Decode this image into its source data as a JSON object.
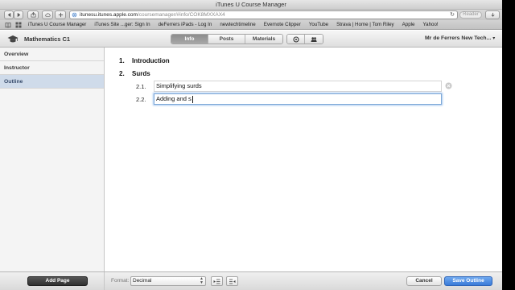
{
  "window": {
    "title": "iTunes U Course Manager"
  },
  "toolbar": {
    "url_host": "itunesu.itunes.apple.com",
    "url_path": "/coursemanager/#info/COK8MXXAX4",
    "reader_label": "Reader"
  },
  "bookmarks": [
    "iTunes U Course Manager",
    "iTunes Site ...ger: Sign In",
    "deFerrers iPads - Log In",
    "newtechtimeline",
    "Evernote Clipper",
    "YouTube",
    "Strava | Home | Tom Riley",
    "Apple",
    "Yahoo!"
  ],
  "header": {
    "course_title": "Mathematics C1",
    "tabs": [
      {
        "label": "Info",
        "active": true
      },
      {
        "label": "Posts",
        "active": false
      },
      {
        "label": "Materials",
        "active": false
      }
    ],
    "user_menu": "Mr de Ferrers New Tech...",
    "user_caret": "▾"
  },
  "sidebar": {
    "items": [
      {
        "label": "Overview",
        "selected": false
      },
      {
        "label": "Instructor",
        "selected": false
      },
      {
        "label": "Outline",
        "selected": true
      }
    ]
  },
  "outline": {
    "topics": [
      {
        "num": "1.",
        "title": "Introduction"
      },
      {
        "num": "2.",
        "title": "Surds"
      }
    ],
    "subtopics": [
      {
        "num": "2.1.",
        "value": "Simplifying surds"
      },
      {
        "num": "2.2.",
        "value": "Adding and s"
      }
    ]
  },
  "footer": {
    "add_page": "Add Page",
    "format_label": "Format:",
    "format_value": "Decimal",
    "cancel": "Cancel",
    "save": "Save Outline"
  },
  "colors": {
    "accent": "#3a7bd8",
    "selected_sidebar": "#cfdbea",
    "focus_ring": "#7fa9d8"
  }
}
